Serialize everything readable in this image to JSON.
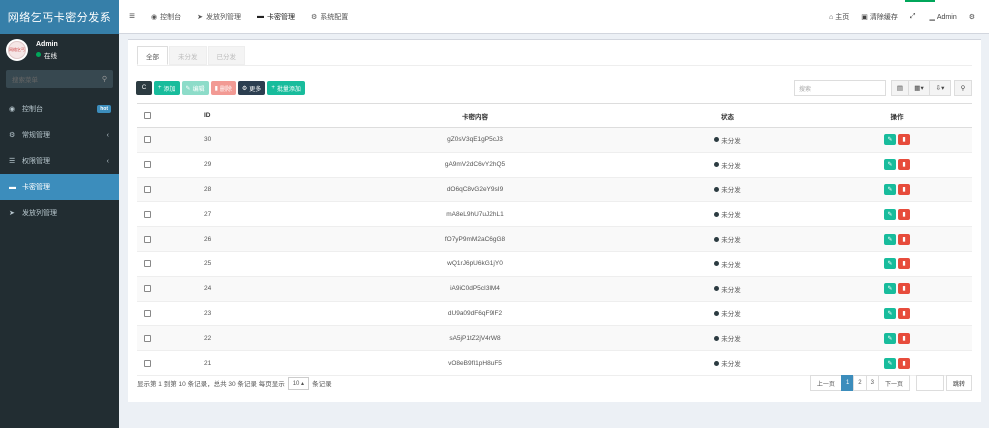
{
  "brand": "网络乞丐卡密分发系",
  "user": {
    "name": "Admin",
    "status": "在线",
    "avatar_text": "网络乞丐"
  },
  "sidebar": {
    "search_placeholder": "搜索菜单",
    "items": [
      {
        "icon": "dashboard-icon",
        "glyph": "◉",
        "label": "控制台",
        "badge": "hot",
        "active": false
      },
      {
        "icon": "cogs-icon",
        "glyph": "⚙",
        "label": "常规管理",
        "chevron": "‹",
        "active": false
      },
      {
        "icon": "group-icon",
        "glyph": "☰",
        "label": "权限管理",
        "chevron": "‹",
        "active": false
      },
      {
        "icon": "card-icon",
        "glyph": "▬",
        "label": "卡密管理",
        "active": true
      },
      {
        "icon": "send-icon",
        "glyph": "➤",
        "label": "发放列管理",
        "active": false
      }
    ]
  },
  "topbar": {
    "toggle": "≡",
    "nav": [
      {
        "glyph": "◉",
        "label": "控制台"
      },
      {
        "glyph": "➤",
        "label": "发放列管理"
      },
      {
        "glyph": "▬",
        "label": "卡密管理"
      },
      {
        "glyph": "⚙",
        "label": "系统配置"
      }
    ],
    "right": [
      {
        "glyph": "⌂",
        "label": "主页"
      },
      {
        "glyph": "▣",
        "label": "清除缓存"
      },
      {
        "glyph": "⤢",
        "label": ""
      },
      {
        "glyph": "▁",
        "label": "Admin"
      },
      {
        "glyph": "⚙",
        "label": ""
      }
    ]
  },
  "tabs": [
    "全部",
    "未分发",
    "已分发"
  ],
  "toolbar": {
    "refresh": "C",
    "add": "添加",
    "edit": "编辑",
    "delete": "删除",
    "more": "更多",
    "batch_add": "批量添加"
  },
  "search_placeholder": "搜索",
  "table": {
    "headers": {
      "id": "ID",
      "card": "卡密内容",
      "status": "状态",
      "op": "操作"
    },
    "rows": [
      {
        "id": "30",
        "card": "gZ0sV3qE1gP5cJ3",
        "status": "未分发"
      },
      {
        "id": "29",
        "card": "gA9mV2dC6vY2hQ5",
        "status": "未分发"
      },
      {
        "id": "28",
        "card": "dO6qC8vG2eY9sI9",
        "status": "未分发"
      },
      {
        "id": "27",
        "card": "mA8eL9hU7uJ2hL1",
        "status": "未分发"
      },
      {
        "id": "26",
        "card": "fO7yP9mM2aC6gG8",
        "status": "未分发"
      },
      {
        "id": "25",
        "card": "wQ1rJ6pU6kG1jY0",
        "status": "未分发"
      },
      {
        "id": "24",
        "card": "iA9iC0dP5cI3lM4",
        "status": "未分发"
      },
      {
        "id": "23",
        "card": "dU9a09dF6qF9lF2",
        "status": "未分发"
      },
      {
        "id": "22",
        "card": "sA5jP1tZ2jV4rW8",
        "status": "未分发"
      },
      {
        "id": "21",
        "card": "vO8eB9fI1pH8uF5",
        "status": "未分发"
      }
    ]
  },
  "footer": {
    "summary": "显示第 1 到第 10 条记录，总共 30 条记录 每页显示",
    "page_size": "10 ▴",
    "suffix": "条记录",
    "prev": "上一页",
    "pages": [
      "1",
      "2",
      "3"
    ],
    "next": "下一页",
    "jump": "跳转"
  }
}
